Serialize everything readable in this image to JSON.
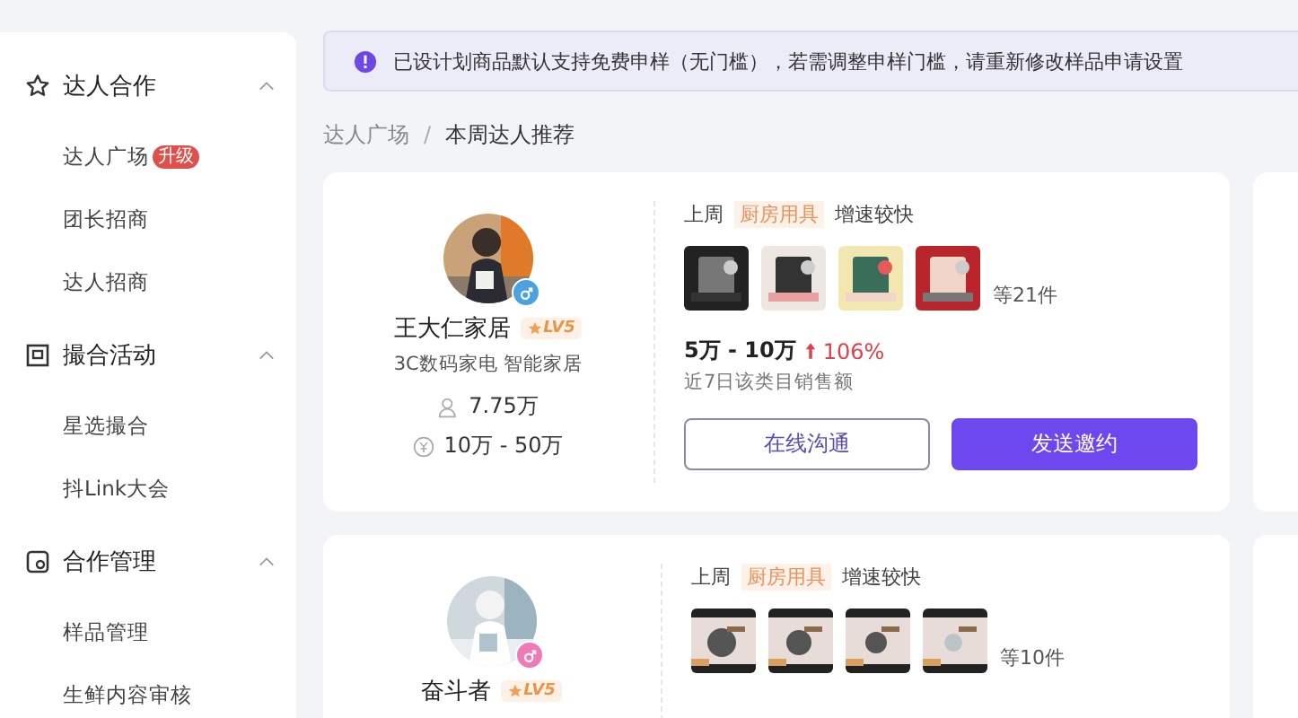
{
  "sidebar": {
    "groups": [
      {
        "title": "达人合作",
        "expanded": true,
        "items": [
          {
            "label": "达人广场",
            "badge": "升级"
          },
          {
            "label": "团长招商"
          },
          {
            "label": "达人招商"
          }
        ]
      },
      {
        "title": "撮合活动",
        "expanded": true,
        "items": [
          {
            "label": "星选撮合"
          },
          {
            "label": "抖Link大会"
          }
        ]
      },
      {
        "title": "合作管理",
        "expanded": true,
        "items": [
          {
            "label": "样品管理"
          },
          {
            "label": "生鲜内容审核"
          }
        ]
      }
    ]
  },
  "notice": "已设计划商品默认支持免费申样（无门槛），若需调整申样门槛，请重新修改样品申请设置",
  "breadcrumb": [
    {
      "label": "达人广场",
      "current": false
    },
    {
      "label": "本周达人推荐",
      "current": true
    }
  ],
  "breadcrumb_separator": "/",
  "cards": [
    {
      "name": "王大仁家居",
      "level": "LV5",
      "color": "#4aa3e0",
      "tags": "3C数码家电 智能家居",
      "fans": "7.75万",
      "sales": "10万 - 50万",
      "trend": {
        "prefix": "上周",
        "category": "厨房用具",
        "suffix": "增速较快"
      },
      "products": [
        {
          "kind": "picture"
        },
        {
          "kind": "picture"
        },
        {
          "kind": "picture"
        },
        {
          "kind": "picture"
        }
      ],
      "product_count": "等21件",
      "range": "5万 - 10万",
      "growth": "106%",
      "range_caption": "近7日该类目销售额",
      "buttons": [
        "在线沟通",
        "发送邀约"
      ]
    },
    {
      "name": "奋斗者",
      "level": "LV5",
      "color": "#f07ab8",
      "trend": {
        "prefix": "上周",
        "category": "厨房用具",
        "suffix": "增速较快"
      },
      "products": [
        {
          "kind": "picture"
        },
        {
          "kind": "picture"
        },
        {
          "kind": "picture"
        },
        {
          "kind": "picture"
        }
      ],
      "product_count": "等10件"
    }
  ]
}
